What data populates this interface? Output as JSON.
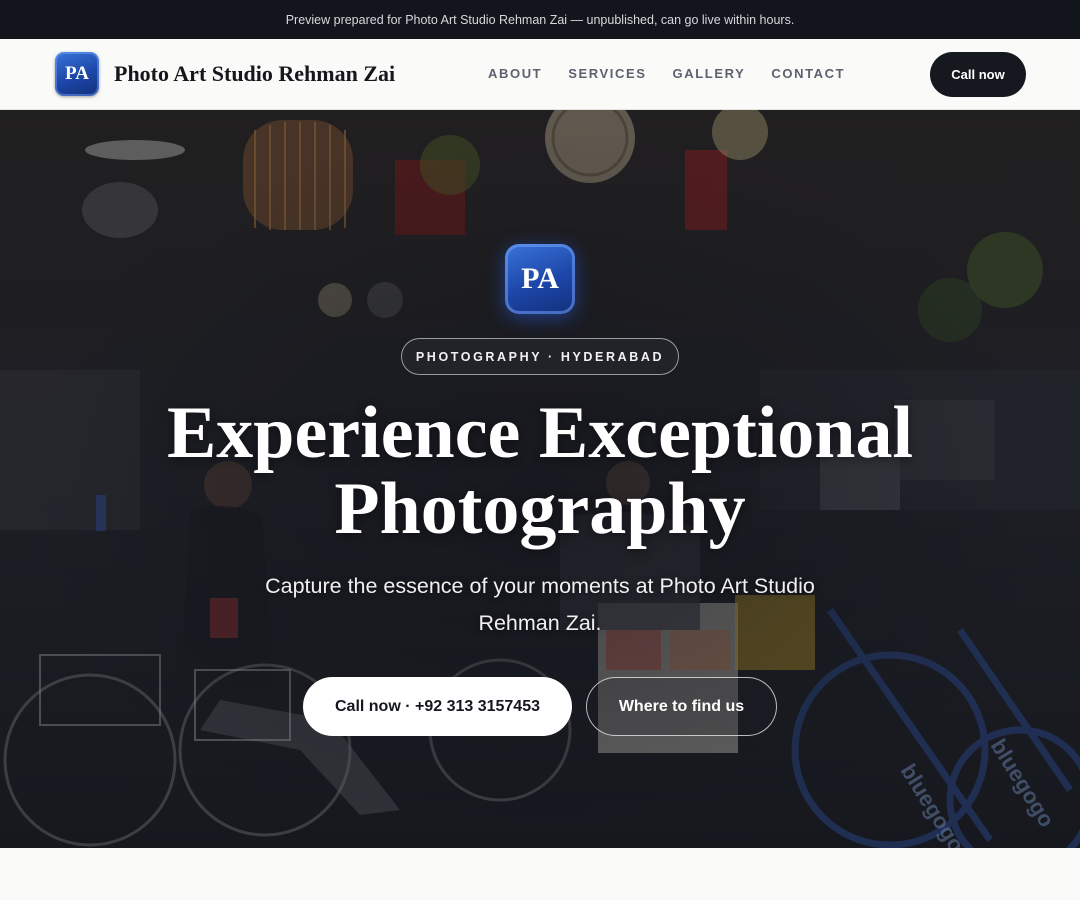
{
  "topbar": {
    "notice": "Preview prepared for Photo Art Studio Rehman Zai — unpublished, can go live within hours."
  },
  "header": {
    "logo_initials": "PA",
    "brand_name": "Photo Art Studio Rehman Zai",
    "nav": [
      {
        "label": "ABOUT"
      },
      {
        "label": "SERVICES"
      },
      {
        "label": "GALLERY"
      },
      {
        "label": "CONTACT"
      }
    ],
    "cta_label": "Call now"
  },
  "hero": {
    "badge_initials": "PA",
    "eyebrow": "PHOTOGRAPHY · HYDERABAD",
    "headline_line1": "Experience Exceptional",
    "headline_line2": "Photography",
    "subtitle": "Capture the essence of your moments at Photo Art Studio Rehman Zai.",
    "primary_button": "Call now · +92 313 3157453",
    "secondary_button": "Where to find us"
  },
  "colors": {
    "brand_blue": "#1c46a8",
    "dark": "#16181f",
    "background": "#fafaf8"
  }
}
